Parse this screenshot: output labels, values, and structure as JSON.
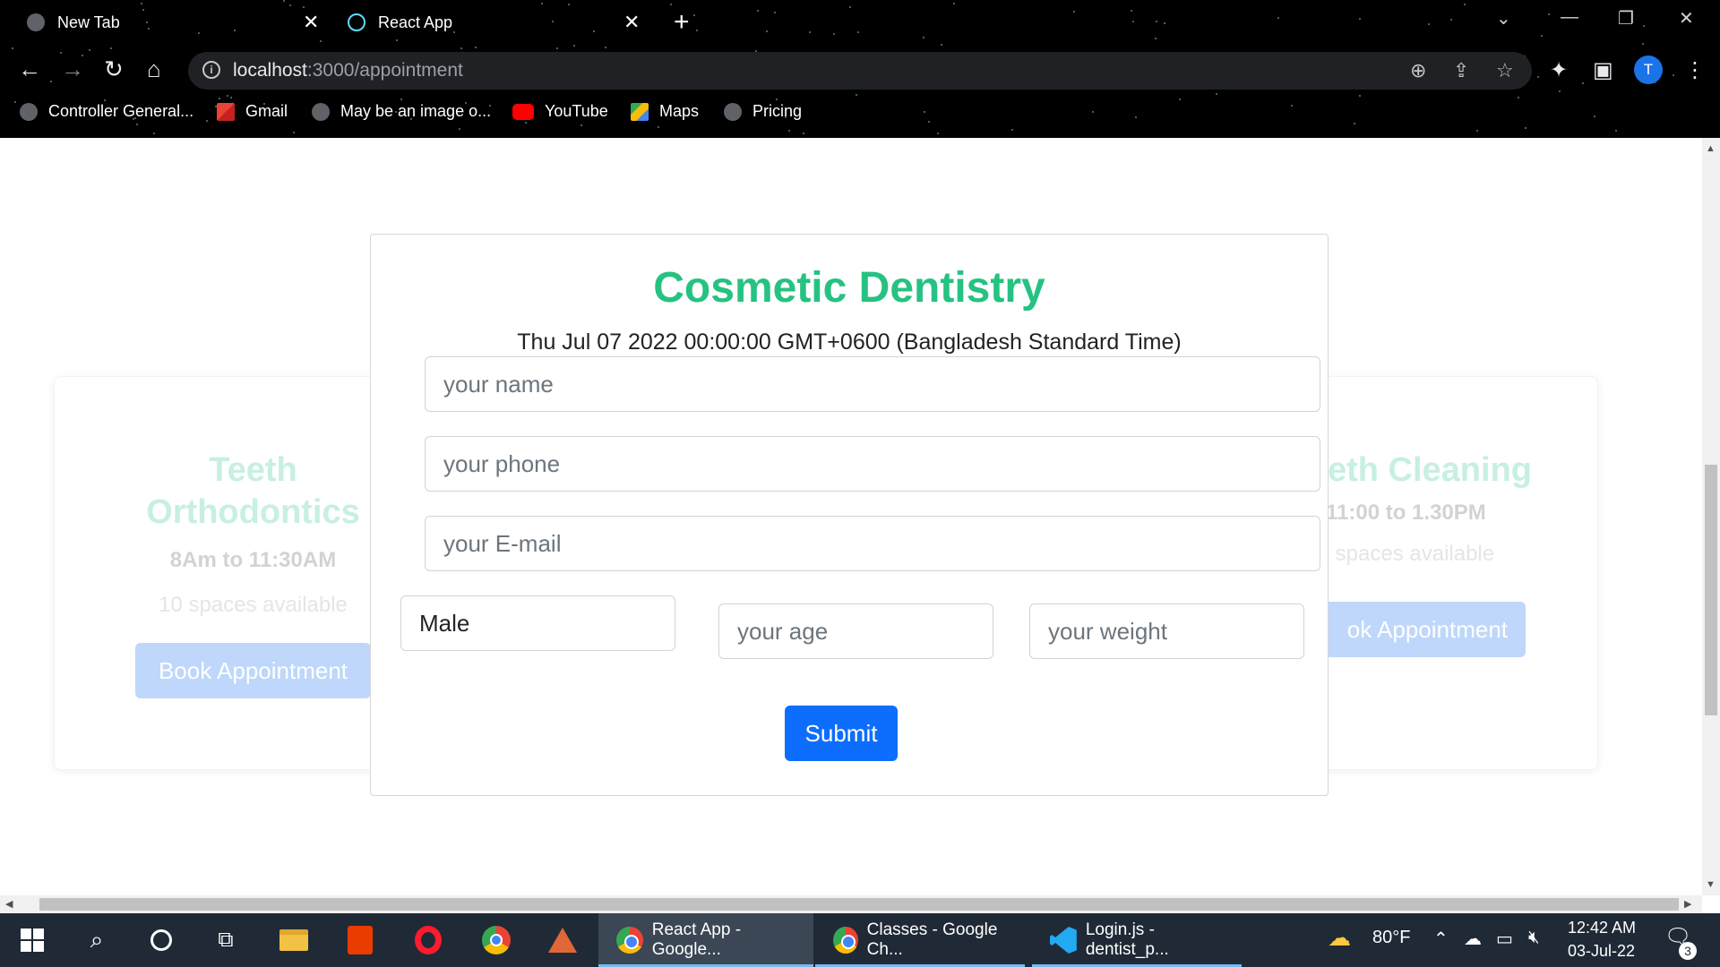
{
  "browser": {
    "tabs": [
      {
        "title": "New Tab",
        "favicon": "globe-icon"
      },
      {
        "title": "React App",
        "favicon": "react-icon"
      }
    ],
    "url_host": "localhost",
    "url_rest": ":3000/appointment",
    "profile_initial": "T",
    "bookmarks": [
      {
        "label": "Controller General...",
        "icon": "globe-icon"
      },
      {
        "label": "Gmail",
        "icon": "gmail-icon"
      },
      {
        "label": "May be an image o...",
        "icon": "globe-icon"
      },
      {
        "label": "YouTube",
        "icon": "youtube-icon"
      },
      {
        "label": "Maps",
        "icon": "maps-icon"
      },
      {
        "label": "Pricing",
        "icon": "globe-icon"
      }
    ]
  },
  "services": [
    {
      "title_line1": "Teeth",
      "title_line2": "Orthodontics",
      "time": "8Am to 11:30AM",
      "spaces": "10 spaces available",
      "button": "Book Appointment"
    },
    {
      "title": "eth Cleaning",
      "time": "11:00 to 1.30PM",
      "spaces": ") spaces available",
      "button": "ok Appointment"
    }
  ],
  "modal": {
    "title": "Cosmetic Dentistry",
    "date": "Thu Jul 07 2022 00:00:00 GMT+0600 (Bangladesh Standard Time)",
    "name_placeholder": "your name",
    "phone_placeholder": "your phone",
    "email_placeholder": "your E-mail",
    "gender_value": "Male",
    "age_placeholder": "your age",
    "weight_placeholder": "your weight",
    "submit_label": "Submit"
  },
  "taskbar": {
    "apps": [
      {
        "label": "React App - Google...",
        "active": true
      },
      {
        "label": "Classes - Google Ch...",
        "active": false
      },
      {
        "label": "Login.js - dentist_p...",
        "active": false
      }
    ],
    "weather": "80°F",
    "time": "12:42 AM",
    "date": "03-Jul-22",
    "notification_count": "3"
  },
  "colors": {
    "accent_green": "#26c281",
    "submit_blue": "#0d6efd",
    "faded_button": "#bed7fb"
  }
}
